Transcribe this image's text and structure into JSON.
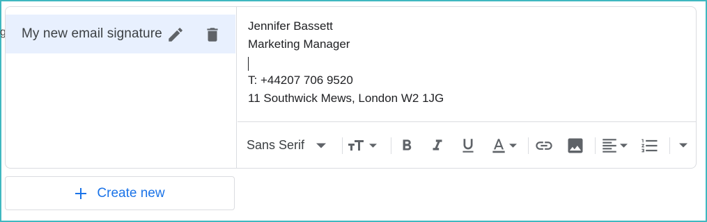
{
  "left_edge_fragment": "g",
  "signatures": {
    "items": [
      {
        "name": "My new email signature"
      }
    ]
  },
  "editor": {
    "lines": [
      "Jennifer Bassett",
      "Marketing Manager",
      "",
      "T: +44207 706 9520",
      "11 Southwick Mews, London W2 1JG"
    ]
  },
  "toolbar": {
    "font_family": "Sans Serif",
    "buttons": [
      "font-size-icon",
      "bold-icon",
      "italic-icon",
      "underline-icon",
      "text-color-icon",
      "link-icon",
      "image-icon",
      "align-icon",
      "numbered-list-icon",
      "more-options-icon"
    ]
  },
  "create_new": {
    "label": "Create new"
  },
  "colors": {
    "accent": "#1a73e8",
    "selected_bg": "#e8f0fe",
    "border": "#dadce0",
    "icon": "#5f6368",
    "frame": "#3fb8c0"
  }
}
